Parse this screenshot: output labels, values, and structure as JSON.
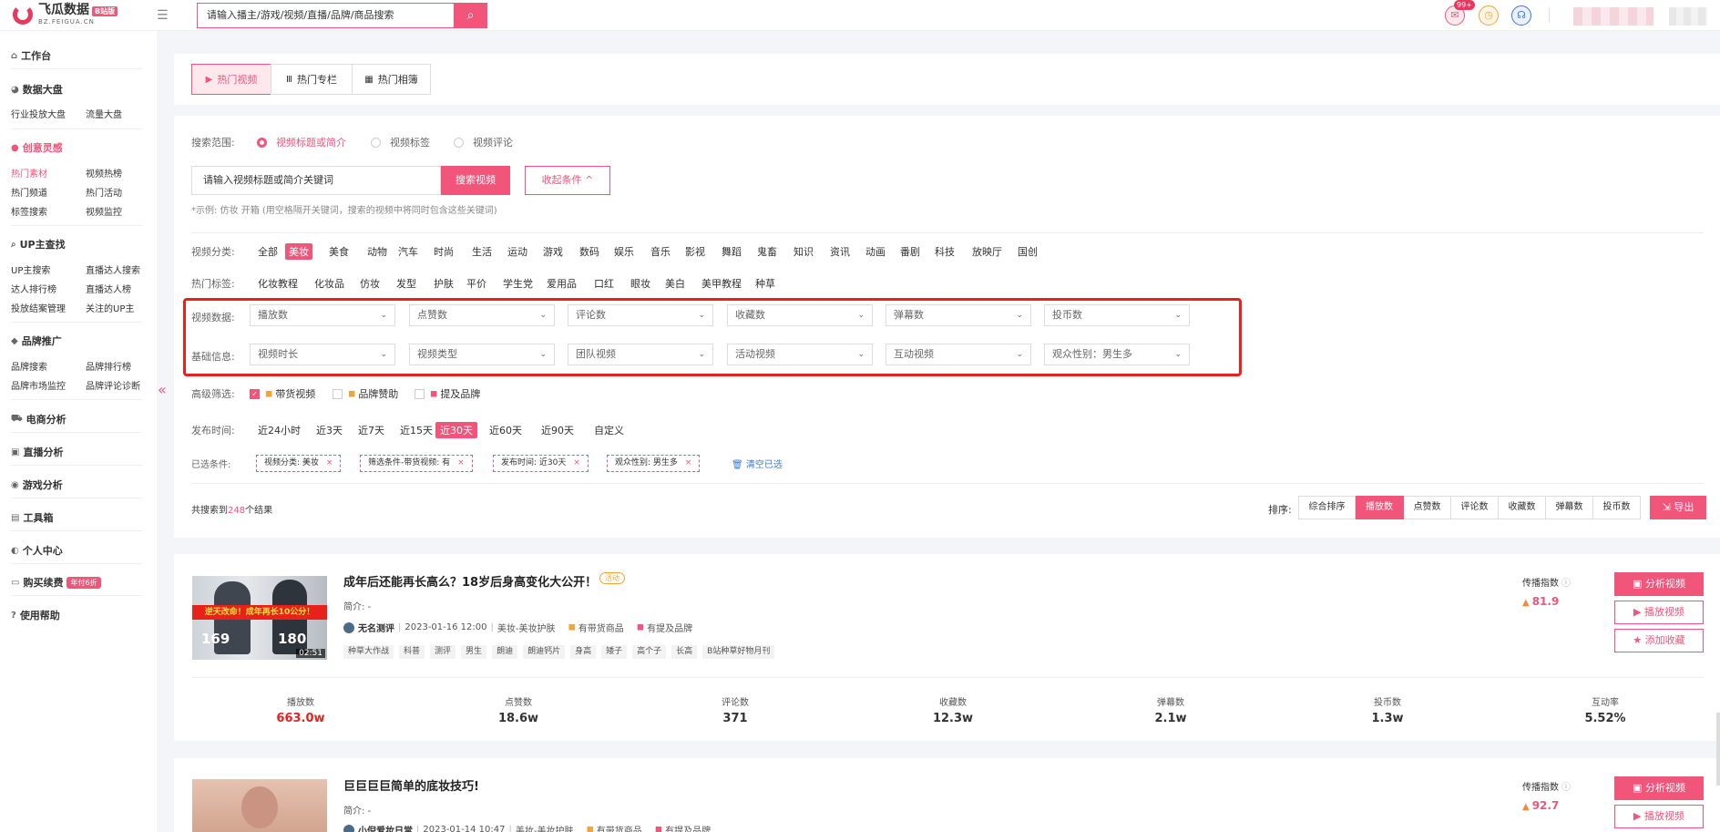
{
  "brand": {
    "name": "飞瓜数据",
    "sub": "BZ.FEIGUA.CN",
    "badge": "B站版"
  },
  "top_search": {
    "placeholder": "请输入播主/游戏/视频/直播/品牌/商品搜索"
  },
  "notifications": {
    "count": "99+"
  },
  "sidebar": {
    "workbench": "工作台",
    "dashboard": {
      "title": "数据大盘",
      "items": [
        "行业投放大盘",
        "流量大盘"
      ]
    },
    "creative": {
      "title": "创意灵感",
      "items": [
        "热门素材",
        "视频热榜",
        "热门频道",
        "热门活动",
        "标签搜索",
        "视频监控"
      ]
    },
    "up": {
      "title": "UP主查找",
      "items": [
        "UP主搜索",
        "直播达人搜索",
        "达人排行榜",
        "直播达人榜",
        "投放结案管理",
        "关注的UP主"
      ]
    },
    "brand_promo": {
      "title": "品牌推广",
      "items": [
        "品牌搜索",
        "品牌排行榜",
        "品牌市场监控",
        "品牌评论诊断"
      ]
    },
    "ecommerce": "电商分析",
    "live": "直播分析",
    "game": "游戏分析",
    "tools": "工具箱",
    "personal": "个人中心",
    "purchase": "购买续费",
    "purchase_badge": "年付6折",
    "help": "使用帮助"
  },
  "tabs": [
    "热门视频",
    "热门专栏",
    "热门相簿"
  ],
  "search_scope": {
    "label": "搜索范围:",
    "options": [
      "视频标题或简介",
      "视频标签",
      "视频评论"
    ]
  },
  "keyword": {
    "placeholder": "请输入视频标题或简介关键词",
    "button": "搜索视频",
    "collapse": "收起条件 ^"
  },
  "hint": "*示例: 仿妆 开箱 (用空格隔开关键词，搜索的视频中将同时包含这些关键词)",
  "category": {
    "label": "视频分类:",
    "items": [
      "全部",
      "美妆",
      "美食",
      "动物",
      "汽车",
      "时尚",
      "生活",
      "运动",
      "游戏",
      "数码",
      "娱乐",
      "音乐",
      "影视",
      "舞蹈",
      "鬼畜",
      "知识",
      "资讯",
      "动画",
      "番剧",
      "科技",
      "放映厅",
      "国创"
    ]
  },
  "hot_tags": {
    "label": "热门标签:",
    "items": [
      "化妆教程",
      "化妆品",
      "仿妆",
      "发型",
      "护肤",
      "平价",
      "学生党",
      "爱用品",
      "口红",
      "眼妆",
      "美白",
      "美甲教程",
      "种草"
    ]
  },
  "video_data": {
    "label": "视频数据:",
    "selects": [
      "播放数",
      "点赞数",
      "评论数",
      "收藏数",
      "弹幕数",
      "投币数"
    ]
  },
  "basic_info": {
    "label": "基础信息:",
    "selects": [
      "视频时长",
      "视频类型",
      "团队视频",
      "活动视频",
      "互动视频",
      "观众性别：男生多"
    ]
  },
  "advanced": {
    "label": "高级筛选:",
    "options": [
      "带货视频",
      "品牌赞助",
      "提及品牌"
    ]
  },
  "publish_time": {
    "label": "发布时间:",
    "options": [
      "近24小时",
      "近3天",
      "近7天",
      "近15天",
      "近30天",
      "近60天",
      "近90天",
      "自定义"
    ]
  },
  "selected": {
    "label": "已选条件:",
    "chips": [
      "视频分类: 美妆",
      "筛选条件-带货视频: 有",
      "发布时间: 近30天",
      "观众性别: 男生多"
    ],
    "clear": "清空已选"
  },
  "results": {
    "prefix": "共搜索到",
    "count": "248",
    "suffix": "个结果"
  },
  "sort": {
    "label": "排序:",
    "options": [
      "综合排序",
      "播放数",
      "点赞数",
      "评论数",
      "收藏数",
      "弹幕数",
      "投币数"
    ],
    "export": "导出"
  },
  "videos": [
    {
      "thumb_banner": "逆天改命！成年再长10公分！",
      "thumb_n1": "169",
      "thumb_n2": "180",
      "duration": "02:51",
      "title": "成年后还能再长高么？18岁后身高变化大公开！",
      "tag": "活动",
      "intro": "简介: -",
      "author": "无名测评",
      "date": "2023-01-16 12:00",
      "category": "美妆-美妆护肤",
      "goods": "有带货商品",
      "brand": "有提及品牌",
      "keywords": [
        "种草大作战",
        "科普",
        "测评",
        "男生",
        "朗迪",
        "朗迪钙片",
        "身高",
        "矮子",
        "高个子",
        "长高",
        "B站种草好物月刊"
      ],
      "score_label": "传播指数",
      "score": "81.9",
      "actions": [
        "分析视频",
        "播放视频",
        "添加收藏"
      ],
      "stats": [
        {
          "label": "播放数",
          "value": "663.0w"
        },
        {
          "label": "点赞数",
          "value": "18.6w"
        },
        {
          "label": "评论数",
          "value": "371"
        },
        {
          "label": "收藏数",
          "value": "12.3w"
        },
        {
          "label": "弹幕数",
          "value": "2.1w"
        },
        {
          "label": "投币数",
          "value": "1.3w"
        },
        {
          "label": "互动率",
          "value": "5.52%"
        }
      ]
    },
    {
      "title": "巨巨巨巨简单的底妆技巧!",
      "intro": "简介: -",
      "author": "小倪爱妆日常",
      "date": "2023-01-14 10:47",
      "category": "美妆-美妆护肤",
      "goods": "有带货商品",
      "brand": "有提及品牌",
      "score_label": "传播指数",
      "score": "92.7",
      "actions": [
        "分析视频",
        "播放视频"
      ]
    }
  ]
}
